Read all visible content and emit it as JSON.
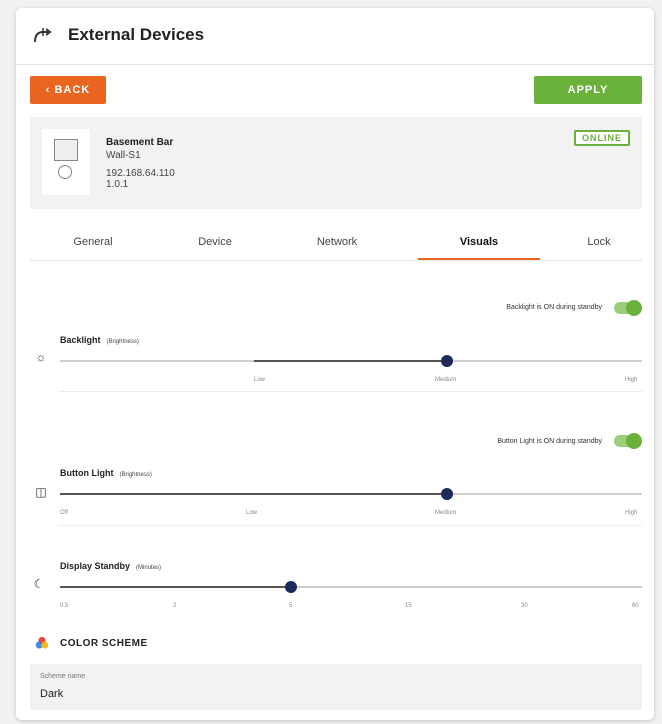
{
  "header": {
    "title": "External Devices",
    "icon": "external-device-icon"
  },
  "actions": {
    "back_label": "BACK",
    "apply_label": "APPLY",
    "back_color": "#e8661f",
    "apply_color": "#6ab23a"
  },
  "device": {
    "name": "Basement Bar",
    "model": "Wall-S1",
    "ip": "192.168.64.110",
    "version": "1.0.1",
    "status": "ONLINE"
  },
  "tabs": [
    {
      "label": "General"
    },
    {
      "label": "Device"
    },
    {
      "label": "Network"
    },
    {
      "label": "Visuals",
      "active": true
    },
    {
      "label": "Lock"
    }
  ],
  "backlight": {
    "toggle_label": "Backlight is ON during standby",
    "toggle_on": true,
    "title": "Backlight",
    "subtitle": "(Brightness)",
    "ticks": [
      "Low",
      "Medium",
      "High"
    ],
    "value": "Medium"
  },
  "button_light": {
    "toggle_label": "Button Light is ON during standby",
    "toggle_on": true,
    "title": "Button Light",
    "subtitle": "(Brightness)",
    "ticks": [
      "Off",
      "Low",
      "Medium",
      "High"
    ],
    "value": "Medium"
  },
  "display_standby": {
    "title": "Display Standby",
    "subtitle": "(Minutes)",
    "ticks": [
      "0.5",
      "2",
      "5",
      "15",
      "30",
      "60"
    ],
    "value": "5"
  },
  "color_scheme": {
    "title": "COLOR SCHEME",
    "field_label": "Scheme name",
    "field_value": "Dark"
  }
}
